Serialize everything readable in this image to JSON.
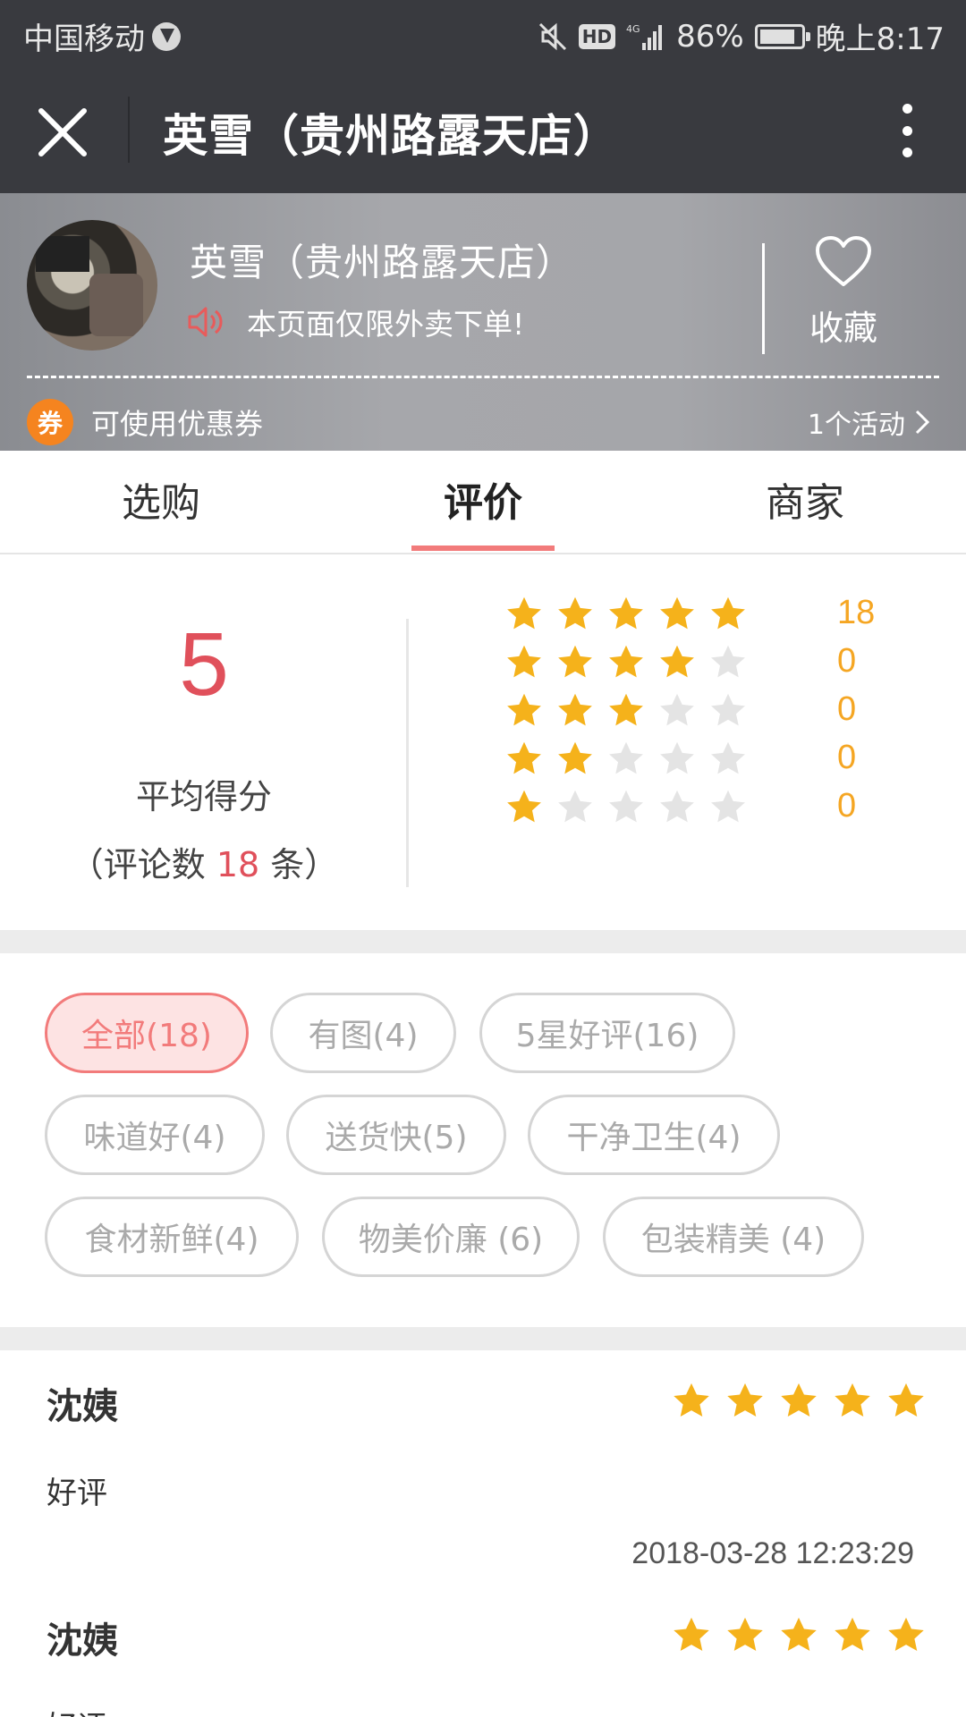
{
  "status_bar": {
    "carrier": "中国移动",
    "network": "4G",
    "hd": "HD",
    "battery": "86%",
    "time": "晚上8:17"
  },
  "title_bar": {
    "title": "英雪（贵州路露天店）"
  },
  "shop": {
    "name": "英雪（贵州路露天店）",
    "notice": "本页面仅限外卖下单!",
    "favorite_label": "收藏",
    "coupon_badge": "券",
    "coupon_text": "可使用优惠券",
    "activity_link": "1个活动"
  },
  "tabs": [
    "选购",
    "评价",
    "商家"
  ],
  "active_tab": "评价",
  "summary": {
    "average_score": "5",
    "average_label": "平均得分",
    "review_count_prefix": "（评论数 ",
    "review_count": "18",
    "review_count_suffix": " 条）",
    "distribution": [
      {
        "stars": 5,
        "count": "18"
      },
      {
        "stars": 4,
        "count": "0"
      },
      {
        "stars": 3,
        "count": "0"
      },
      {
        "stars": 2,
        "count": "0"
      },
      {
        "stars": 1,
        "count": "0"
      }
    ]
  },
  "filter_tags": [
    "全部(18)",
    "有图(4)",
    "5星好评(16)",
    "味道好(4)",
    "送货快(5)",
    "干净卫生(4)",
    "食材新鲜(4)",
    "物美价廉 (6)",
    "包装精美 (4)"
  ],
  "selected_tag": "全部(18)",
  "reviews": [
    {
      "reviewer": "沈姨",
      "rating": 5,
      "text": "好评",
      "date": "2018-03-28 12:23:29"
    },
    {
      "reviewer": "沈姨",
      "rating": 5,
      "text": "好评",
      "date": ""
    }
  ],
  "colors": {
    "header_bg": "#393a3f",
    "accent_red": "#e0505b",
    "tag_selected": "#f27b7b",
    "star_gold": "#f5b21b",
    "star_empty": "#e4e4e4",
    "coupon_orange": "#f5841f"
  },
  "icons": {
    "close": "close-icon",
    "more": "more-vertical-icon",
    "speaker": "speaker-icon",
    "heart": "heart-icon",
    "chevron": "chevron-right-icon"
  }
}
